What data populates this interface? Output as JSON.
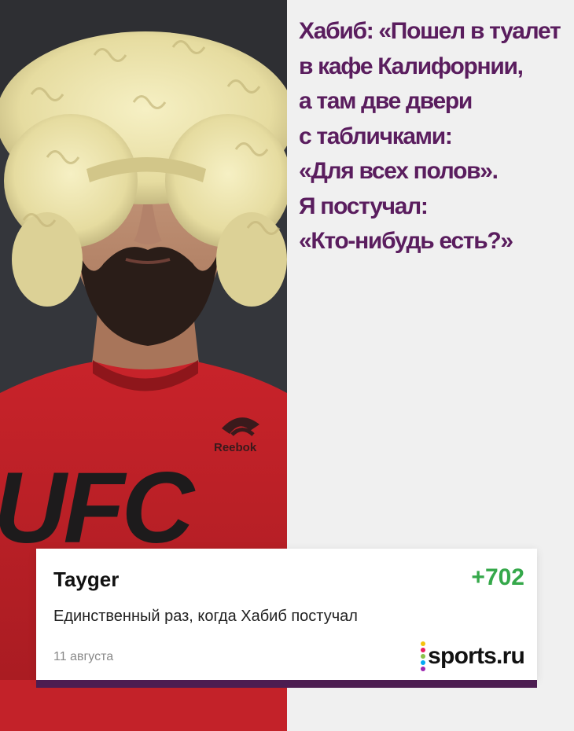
{
  "headline": "Хабиб: «Пошел в туалет\nв кафе Калифорнии,\nа там две двери\nс табличками:\n«Для всех полов».\nЯ постучал:\n«Кто-нибудь есть?»",
  "photo": {
    "shirt_brand": "Reebok",
    "shirt_logo": "UFC"
  },
  "comment": {
    "author": "Tayger",
    "score": "+702",
    "text": "Единственный раз, когда Хабиб постучал",
    "date": "11 августа"
  },
  "logo": {
    "text": "sports.ru",
    "dot_colors": [
      "#f4c20d",
      "#e91e63",
      "#8bc34a",
      "#03a9f4",
      "#9c27b0"
    ]
  },
  "colors": {
    "headline": "#5a1d5e",
    "score": "#35a84a",
    "card_bar": "#4c1d51"
  }
}
